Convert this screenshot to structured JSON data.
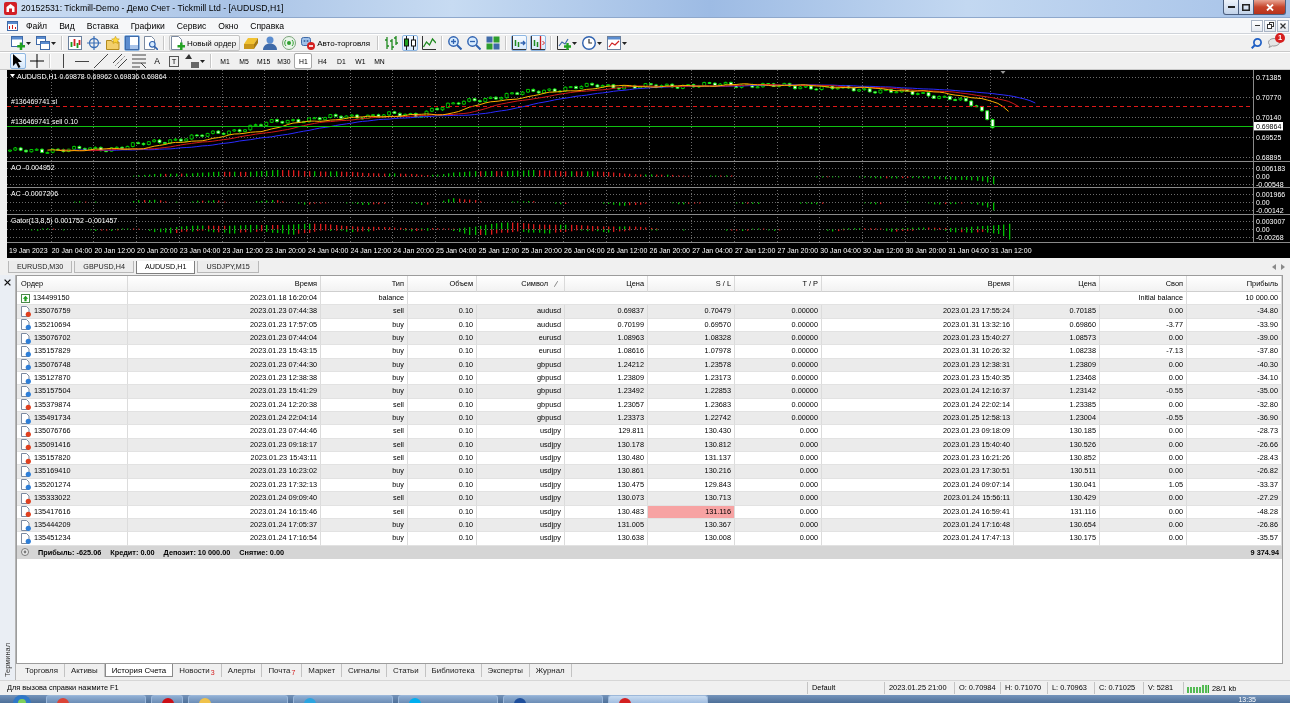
{
  "window": {
    "title": "20152531: Tickmill-Demo - Демо Счет - Tickmill Ltd - [AUDUSD,H1]"
  },
  "menu": [
    "Файл",
    "Вид",
    "Вставка",
    "Графики",
    "Сервис",
    "Окно",
    "Справка"
  ],
  "toolbar": {
    "new_order": "Новый ордер",
    "auto_trading": "Авто-торговля",
    "terminal_on": true,
    "chart_types": [
      {
        "selected": false
      },
      {
        "selected": true
      },
      {
        "selected": false
      }
    ],
    "auto_scroll_on": true,
    "chart_shift_on": true,
    "notifications": "1"
  },
  "drawing_toolbar": {
    "cursor_modes": [
      {
        "selected": true
      },
      {
        "selected": false
      }
    ],
    "text_tools": [
      {
        "kind": "text",
        "label": "A"
      },
      {
        "kind": "label",
        "label": "T"
      }
    ],
    "timeframes": [
      {
        "label": "M1",
        "selected": false
      },
      {
        "label": "M5",
        "selected": false
      },
      {
        "label": "M15",
        "selected": false
      },
      {
        "label": "M30",
        "selected": false
      },
      {
        "label": "H1",
        "selected": true
      },
      {
        "label": "H4",
        "selected": false
      },
      {
        "label": "D1",
        "selected": false
      },
      {
        "label": "W1",
        "selected": false
      },
      {
        "label": "MN",
        "selected": false
      }
    ]
  },
  "chart": {
    "title": "AUDUSD,H1 0.69878 0.69962 0.69836 0.69864",
    "order_lines": [
      {
        "kind": "stop_loss",
        "label": "#136469741 sl"
      },
      {
        "kind": "entry",
        "label": "#136469741 sell 0.10"
      }
    ],
    "price_axis": [
      "0.71385",
      "0.70770",
      "0.70140",
      "0.69525",
      "0.68895"
    ],
    "current_price": "0.69864",
    "indicators": [
      {
        "kind": "ao",
        "label": "AO -0.004952",
        "axis": [
          "0.006183",
          "0.00",
          "-0.00548"
        ]
      },
      {
        "kind": "ac",
        "label": "AC -0.0007206",
        "axis": [
          "0.001966",
          "0.00",
          "-0.00142"
        ]
      },
      {
        "kind": "gator",
        "label": "Gator(13,8,5) 0.001752 -0.001457",
        "axis": [
          "0.003007",
          "0.00",
          "-0.00268"
        ]
      }
    ],
    "time_axis": [
      "19 Jan 2023",
      "20 Jan 04:00",
      "20 Jan 12:00",
      "20 Jan 20:00",
      "23 Jan 04:00",
      "23 Jan 12:00",
      "23 Jan 20:00",
      "24 Jan 04:00",
      "24 Jan 12:00",
      "24 Jan 20:00",
      "25 Jan 04:00",
      "25 Jan 12:00",
      "25 Jan 20:00",
      "26 Jan 04:00",
      "26 Jan 12:00",
      "26 Jan 20:00",
      "27 Jan 04:00",
      "27 Jan 12:00",
      "27 Jan 20:00",
      "30 Jan 04:00",
      "30 Jan 12:00",
      "30 Jan 20:00",
      "31 Jan 04:00",
      "31 Jan 12:00"
    ]
  },
  "chart_tabs": [
    {
      "label": "EURUSD,M30",
      "selected": false
    },
    {
      "label": "GBPUSD,H4",
      "selected": false
    },
    {
      "label": "AUDUSD,H1",
      "selected": true
    },
    {
      "label": "USDJPY,M15",
      "selected": false
    }
  ],
  "terminal": {
    "title": "Терминал",
    "columns": [
      {
        "label": "Ордер",
        "sorted": false
      },
      {
        "label": "Время",
        "sorted": false
      },
      {
        "label": "Тип",
        "sorted": false
      },
      {
        "label": "Объем",
        "sorted": false
      },
      {
        "label": "Символ",
        "sorted": true
      },
      {
        "label": "Цена",
        "sorted": false
      },
      {
        "label": "S / L",
        "sorted": false
      },
      {
        "label": "T / P",
        "sorted": false
      },
      {
        "label": "Время",
        "sorted": false
      },
      {
        "label": "Цена",
        "sorted": false
      },
      {
        "label": "Своп",
        "sorted": false
      },
      {
        "label": "Прибыль",
        "sorted": false
      }
    ],
    "rows": [
      {
        "kind": "balance",
        "order": "134499150",
        "open_time": "2023.01.18 16:20:04",
        "type": "balance",
        "comment": "Initial balance",
        "profit": "10 000.00"
      },
      {
        "kind": "sell",
        "order": "135076759",
        "open_time": "2023.01.23 07:44:38",
        "type": "sell",
        "size": "0.10",
        "symbol": "audusd",
        "open_price": "0.69837",
        "sl": "0.70479",
        "tp": "0.00000",
        "close_time": "2023.01.23 17:55:24",
        "close_price": "0.70185",
        "swap": "0.00",
        "profit": "-34.80",
        "sl_highlighted": false
      },
      {
        "kind": "buy",
        "order": "135210694",
        "open_time": "2023.01.23 17:57:05",
        "type": "buy",
        "size": "0.10",
        "symbol": "audusd",
        "open_price": "0.70199",
        "sl": "0.69570",
        "tp": "0.00000",
        "close_time": "2023.01.31 13:32:16",
        "close_price": "0.69860",
        "swap": "-3.77",
        "profit": "-33.90",
        "sl_highlighted": false
      },
      {
        "kind": "buy",
        "order": "135076702",
        "open_time": "2023.01.23 07:44:04",
        "type": "buy",
        "size": "0.10",
        "symbol": "eurusd",
        "open_price": "1.08963",
        "sl": "1.08328",
        "tp": "0.00000",
        "close_time": "2023.01.23 15:40:27",
        "close_price": "1.08573",
        "swap": "0.00",
        "profit": "-39.00",
        "sl_highlighted": false
      },
      {
        "kind": "buy",
        "order": "135157829",
        "open_time": "2023.01.23 15:43:15",
        "type": "buy",
        "size": "0.10",
        "symbol": "eurusd",
        "open_price": "1.08616",
        "sl": "1.07978",
        "tp": "0.00000",
        "close_time": "2023.01.31 10:26:32",
        "close_price": "1.08238",
        "swap": "-7.13",
        "profit": "-37.80",
        "sl_highlighted": false
      },
      {
        "kind": "buy",
        "order": "135076748",
        "open_time": "2023.01.23 07:44:30",
        "type": "buy",
        "size": "0.10",
        "symbol": "gbpusd",
        "open_price": "1.24212",
        "sl": "1.23578",
        "tp": "0.00000",
        "close_time": "2023.01.23 12:38:31",
        "close_price": "1.23809",
        "swap": "0.00",
        "profit": "-40.30",
        "sl_highlighted": false
      },
      {
        "kind": "buy",
        "order": "135127870",
        "open_time": "2023.01.23 12:38:38",
        "type": "buy",
        "size": "0.10",
        "symbol": "gbpusd",
        "open_price": "1.23809",
        "sl": "1.23173",
        "tp": "0.00000",
        "close_time": "2023.01.23 15:40:35",
        "close_price": "1.23468",
        "swap": "0.00",
        "profit": "-34.10",
        "sl_highlighted": false
      },
      {
        "kind": "buy",
        "order": "135157504",
        "open_time": "2023.01.23 15:41:29",
        "type": "buy",
        "size": "0.10",
        "symbol": "gbpusd",
        "open_price": "1.23492",
        "sl": "1.22853",
        "tp": "0.00000",
        "close_time": "2023.01.24 12:16:37",
        "close_price": "1.23142",
        "swap": "-0.55",
        "profit": "-35.00",
        "sl_highlighted": false
      },
      {
        "kind": "sell",
        "order": "135379874",
        "open_time": "2023.01.24 12:20:38",
        "type": "sell",
        "size": "0.10",
        "symbol": "gbpusd",
        "open_price": "1.23057",
        "sl": "1.23683",
        "tp": "0.00000",
        "close_time": "2023.01.24 22:02:14",
        "close_price": "1.23385",
        "swap": "0.00",
        "profit": "-32.80",
        "sl_highlighted": false
      },
      {
        "kind": "buy",
        "order": "135491734",
        "open_time": "2023.01.24 22:04:14",
        "type": "buy",
        "size": "0.10",
        "symbol": "gbpusd",
        "open_price": "1.23373",
        "sl": "1.22742",
        "tp": "0.00000",
        "close_time": "2023.01.25 12:58:13",
        "close_price": "1.23004",
        "swap": "-0.55",
        "profit": "-36.90",
        "sl_highlighted": false
      },
      {
        "kind": "sell",
        "order": "135076766",
        "open_time": "2023.01.23 07:44:46",
        "type": "sell",
        "size": "0.10",
        "symbol": "usdjpy",
        "open_price": "129.811",
        "sl": "130.430",
        "tp": "0.000",
        "close_time": "2023.01.23 09:18:09",
        "close_price": "130.185",
        "swap": "0.00",
        "profit": "-28.73",
        "sl_highlighted": false
      },
      {
        "kind": "sell",
        "order": "135091416",
        "open_time": "2023.01.23 09:18:17",
        "type": "sell",
        "size": "0.10",
        "symbol": "usdjpy",
        "open_price": "130.178",
        "sl": "130.812",
        "tp": "0.000",
        "close_time": "2023.01.23 15:40:40",
        "close_price": "130.526",
        "swap": "0.00",
        "profit": "-26.66",
        "sl_highlighted": false
      },
      {
        "kind": "sell",
        "order": "135157820",
        "open_time": "2023.01.23 15:43:11",
        "type": "sell",
        "size": "0.10",
        "symbol": "usdjpy",
        "open_price": "130.480",
        "sl": "131.137",
        "tp": "0.000",
        "close_time": "2023.01.23 16:21:26",
        "close_price": "130.852",
        "swap": "0.00",
        "profit": "-28.43",
        "sl_highlighted": false
      },
      {
        "kind": "buy",
        "order": "135169410",
        "open_time": "2023.01.23 16:23:02",
        "type": "buy",
        "size": "0.10",
        "symbol": "usdjpy",
        "open_price": "130.861",
        "sl": "130.216",
        "tp": "0.000",
        "close_time": "2023.01.23 17:30:51",
        "close_price": "130.511",
        "swap": "0.00",
        "profit": "-26.82",
        "sl_highlighted": false
      },
      {
        "kind": "buy",
        "order": "135201274",
        "open_time": "2023.01.23 17:32:13",
        "type": "buy",
        "size": "0.10",
        "symbol": "usdjpy",
        "open_price": "130.475",
        "sl": "129.843",
        "tp": "0.000",
        "close_time": "2023.01.24 09:07:14",
        "close_price": "130.041",
        "swap": "1.05",
        "profit": "-33.37",
        "sl_highlighted": false
      },
      {
        "kind": "sell",
        "order": "135333022",
        "open_time": "2023.01.24 09:09:40",
        "type": "sell",
        "size": "0.10",
        "symbol": "usdjpy",
        "open_price": "130.073",
        "sl": "130.713",
        "tp": "0.000",
        "close_time": "2023.01.24 15:56:11",
        "close_price": "130.429",
        "swap": "0.00",
        "profit": "-27.29",
        "sl_highlighted": false
      },
      {
        "kind": "sell",
        "order": "135417616",
        "open_time": "2023.01.24 16:15:46",
        "type": "sell",
        "size": "0.10",
        "symbol": "usdjpy",
        "open_price": "130.483",
        "sl": "131.116",
        "tp": "0.000",
        "close_time": "2023.01.24 16:59:41",
        "close_price": "131.116",
        "swap": "0.00",
        "profit": "-48.28",
        "sl_highlighted": true
      },
      {
        "kind": "buy",
        "order": "135444209",
        "open_time": "2023.01.24 17:05:37",
        "type": "buy",
        "size": "0.10",
        "symbol": "usdjpy",
        "open_price": "131.005",
        "sl": "130.367",
        "tp": "0.000",
        "close_time": "2023.01.24 17:16:48",
        "close_price": "130.654",
        "swap": "0.00",
        "profit": "-26.86",
        "sl_highlighted": false
      },
      {
        "kind": "buy",
        "order": "135451234",
        "open_time": "2023.01.24 17:16:54",
        "type": "buy",
        "size": "0.10",
        "symbol": "usdjpy",
        "open_price": "130.638",
        "sl": "130.008",
        "tp": "0.000",
        "close_time": "2023.01.24 17:47:13",
        "close_price": "130.175",
        "swap": "0.00",
        "profit": "-35.57",
        "sl_highlighted": false
      }
    ],
    "summary": [
      "Прибыль: -625.06",
      "Кредит: 0.00",
      "Депозит: 10 000.00",
      "Снятие: 0.00"
    ],
    "total": "9 374.94",
    "tabs": [
      {
        "label": "Торговля",
        "selected": false
      },
      {
        "label": "Активы",
        "selected": false
      },
      {
        "label": "История Счета",
        "selected": true
      },
      {
        "label": "Новости",
        "badge": "3",
        "selected": false
      },
      {
        "label": "Алерты",
        "selected": false
      },
      {
        "label": "Почта",
        "badge": "7",
        "selected": false
      },
      {
        "label": "Маркет",
        "selected": false
      },
      {
        "label": "Сигналы",
        "selected": false
      },
      {
        "label": "Статьи",
        "selected": false
      },
      {
        "label": "Библиотека",
        "selected": false
      },
      {
        "label": "Эксперты",
        "selected": false
      },
      {
        "label": "Журнал",
        "selected": false
      }
    ]
  },
  "status_bar": {
    "help": "Для вызова справки нажмите F1",
    "profile": "Default",
    "bar_time": "2023.01.25 21:00",
    "open": "O: 0.70984",
    "high": "H: 0.71070",
    "low": "L: 0.70963",
    "close": "C: 0.71025",
    "volume": "V: 5281",
    "traffic": "28/1 kb"
  },
  "taskbar": {
    "clock": "13:35"
  }
}
